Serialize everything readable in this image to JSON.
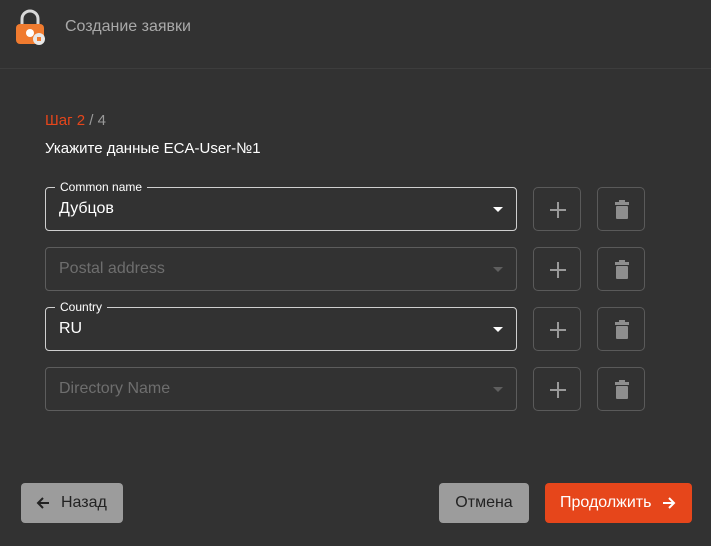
{
  "header": {
    "title": "Создание заявки",
    "logo_icon": "padlock-logo-icon"
  },
  "step": {
    "label": "Шаг 2",
    "separator": " / 4"
  },
  "form": {
    "subtitle": "Укажите данные ECA-User-№1",
    "fields": [
      {
        "label": "Common name",
        "value": "Дубцов",
        "placeholder": ""
      },
      {
        "label": "",
        "value": "",
        "placeholder": "Postal address"
      },
      {
        "label": "Country",
        "value": "RU",
        "placeholder": ""
      },
      {
        "label": "",
        "value": "",
        "placeholder": "Directory Name"
      }
    ],
    "add_icon": "plus-icon",
    "delete_icon": "trash-icon"
  },
  "footer": {
    "back_label": "Назад",
    "cancel_label": "Отмена",
    "next_label": "Продолжить"
  },
  "colors": {
    "background": "#323232",
    "accent": "#e6461b",
    "secondary_button": "#9c9c9c"
  }
}
